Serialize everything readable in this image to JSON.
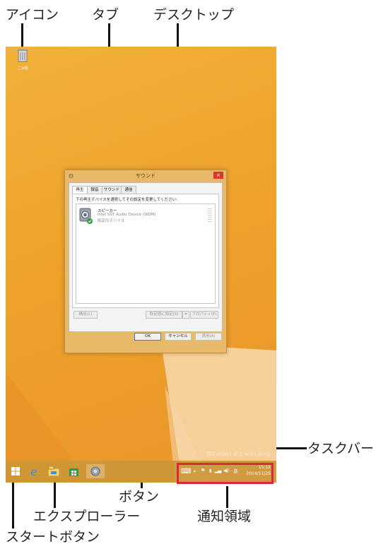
{
  "callouts": {
    "icon": "アイコン",
    "tab": "タブ",
    "desktop": "デスクトップ",
    "taskbar": "タスクバー",
    "button": "ボタン",
    "explorer": "エクスプローラー",
    "notification_area": "通知領域",
    "start_button": "スタートボタン"
  },
  "desktop": {
    "recycle_bin_label": "ごみ箱",
    "watermark": "Windows 8.1 with Bing"
  },
  "dialog": {
    "title": "サウンド",
    "close_glyph": "×",
    "tabs": [
      "再生",
      "録音",
      "サウンド",
      "通信"
    ],
    "instruction": "下の再生デバイスを選択してその設定を変更してください:",
    "device": {
      "name": "スピーカー",
      "driver": "Intel SST Audio Device (WDM)",
      "status": "既定のデバイス"
    },
    "buttons": {
      "configure": "構成(C)",
      "set_default": "既定値に設定(S)",
      "dropdown": "▾",
      "properties": "プロパティ(P)",
      "ok": "OK",
      "cancel": "キャンセル",
      "apply": "適用(A)"
    }
  },
  "taskbar": {
    "icons": [
      "start-icon",
      "internet-explorer-icon",
      "file-explorer-icon",
      "store-icon",
      "sound-settings-icon"
    ],
    "tray": {
      "time": "15:12",
      "date": "2014/11/25"
    }
  },
  "colors": {
    "desktop": "#f0a832",
    "close": "#d9382f"
  }
}
